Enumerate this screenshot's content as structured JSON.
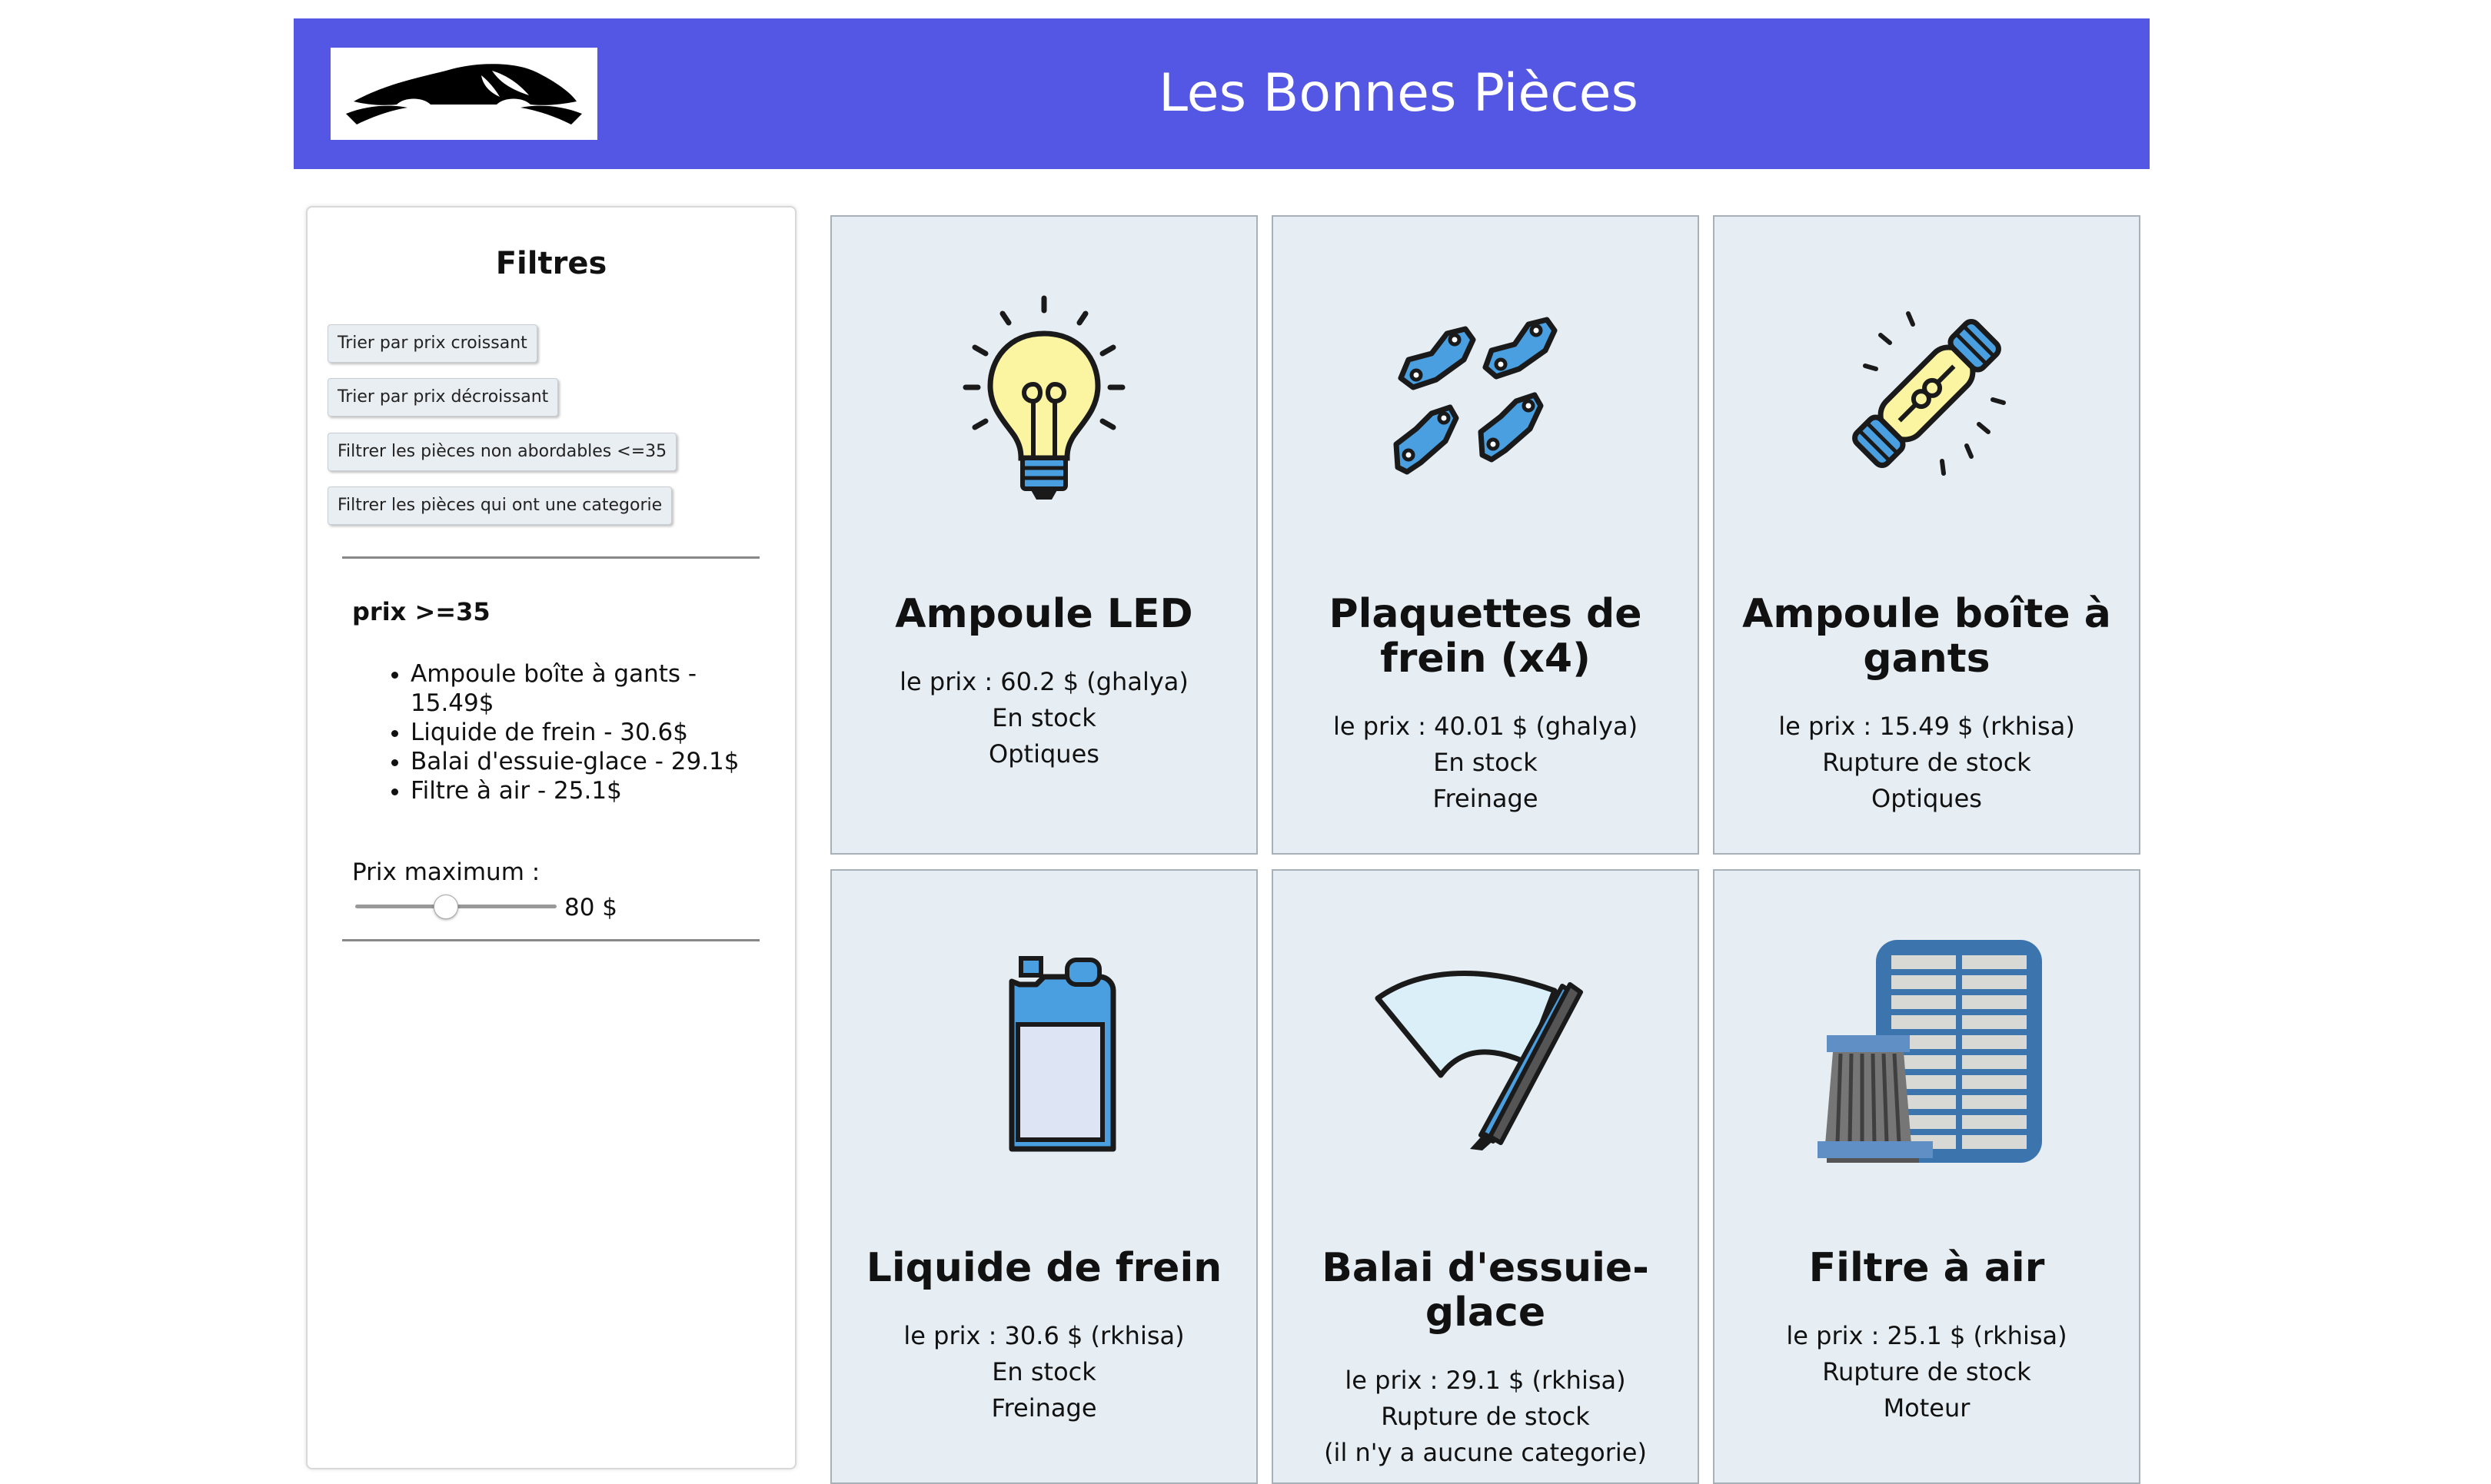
{
  "header": {
    "title": "Les Bonnes Pièces",
    "logo_icon": "car-silhouette-icon"
  },
  "filters": {
    "title": "Filtres",
    "buttons": [
      "Trier par prix croissant",
      "Trier par prix décroissant",
      "Filtrer les pièces non abordables <=35",
      "Filtrer les pièces qui ont une categorie"
    ],
    "affordable_heading": "prix >=35",
    "affordable_items": [
      "Ampoule boîte à gants - 15.49$",
      "Liquide de frein - 30.6$",
      "Balai d'essuie-glace - 29.1$",
      "Filtre à air - 25.1$"
    ],
    "max_price_label": "Prix maximum :",
    "max_price_value": "80 $",
    "max_price_slider_fraction": 0.43
  },
  "products": [
    {
      "name": "Ampoule LED",
      "price": "le prix : 60.2 $ (ghalya)",
      "stock": "En stock",
      "category": "Optiques",
      "icon": "light-bulb-icon"
    },
    {
      "name": "Plaquettes de frein (x4)",
      "price": "le prix : 40.01 $ (ghalya)",
      "stock": "En stock",
      "category": "Freinage",
      "icon": "brake-pads-icon"
    },
    {
      "name": "Ampoule boîte à gants",
      "price": "le prix : 15.49 $ (rkhisa)",
      "stock": "Rupture de stock",
      "category": "Optiques",
      "icon": "fuse-bulb-icon"
    },
    {
      "name": "Liquide de frein",
      "price": "le prix : 30.6 $ (rkhisa)",
      "stock": "En stock",
      "category": "Freinage",
      "icon": "fluid-canister-icon"
    },
    {
      "name": "Balai d'essuie-glace",
      "price": "le prix : 29.1 $ (rkhisa)",
      "stock": "Rupture de stock",
      "category": "(il n'y a aucune categorie)",
      "icon": "wiper-blade-icon"
    },
    {
      "name": "Filtre à air",
      "price": "le prix : 25.1 $ (rkhisa)",
      "stock": "Rupture de stock",
      "category": "Moteur",
      "icon": "air-filter-icon"
    }
  ],
  "colors": {
    "header_bg": "#5457e3",
    "card_bg": "#e6eef4",
    "icon_blue": "#4a9fe0",
    "icon_yellow": "#fbf4a0"
  }
}
